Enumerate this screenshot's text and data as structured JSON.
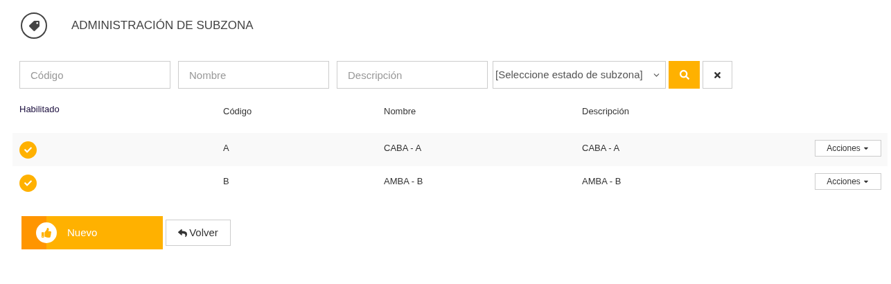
{
  "header": {
    "title": "ADMINISTRACIÓN DE SUBZONA"
  },
  "filters": {
    "codigo": {
      "placeholder": "Código"
    },
    "nombre": {
      "placeholder": "Nombre"
    },
    "descripcion": {
      "placeholder": "Descripción"
    },
    "estado": {
      "value": "[Seleccione estado de subzona]"
    }
  },
  "table": {
    "columns": [
      "Habilitado",
      "Código",
      "Nombre",
      "Descripción"
    ],
    "rows": [
      {
        "enabled": true,
        "codigo": "A",
        "nombre": "CABA - A",
        "descripcion": "CABA - A",
        "actions": "Acciones"
      },
      {
        "enabled": true,
        "codigo": "B",
        "nombre": "AMBA - B",
        "descripcion": "AMBA - B",
        "actions": "Acciones"
      }
    ]
  },
  "buttons": {
    "new": "Nuevo",
    "back": "Volver"
  }
}
